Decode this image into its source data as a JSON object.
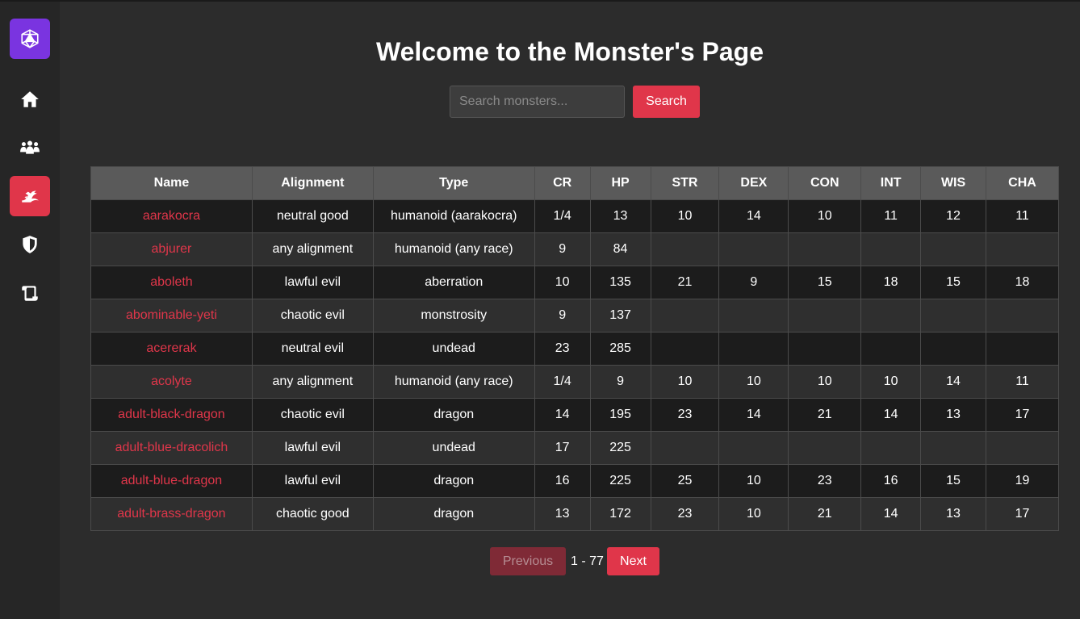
{
  "sidebar": {
    "items": [
      {
        "icon": "d20-dice-icon"
      },
      {
        "icon": "home-icon"
      },
      {
        "icon": "users-icon"
      },
      {
        "icon": "dragon-icon",
        "active": true
      },
      {
        "icon": "shield-icon"
      },
      {
        "icon": "scroll-icon"
      }
    ]
  },
  "page": {
    "title": "Welcome to the Monster's Page"
  },
  "search": {
    "placeholder": "Search monsters...",
    "value": "",
    "button_label": "Search"
  },
  "table": {
    "columns": [
      "Name",
      "Alignment",
      "Type",
      "CR",
      "HP",
      "STR",
      "DEX",
      "CON",
      "INT",
      "WIS",
      "CHA"
    ],
    "rows": [
      [
        "aarakocra",
        "neutral good",
        "humanoid (aarakocra)",
        "1/4",
        "13",
        "10",
        "14",
        "10",
        "11",
        "12",
        "11"
      ],
      [
        "abjurer",
        "any alignment",
        "humanoid (any race)",
        "9",
        "84",
        "",
        "",
        "",
        "",
        "",
        ""
      ],
      [
        "aboleth",
        "lawful evil",
        "aberration",
        "10",
        "135",
        "21",
        "9",
        "15",
        "18",
        "15",
        "18"
      ],
      [
        "abominable-yeti",
        "chaotic evil",
        "monstrosity",
        "9",
        "137",
        "",
        "",
        "",
        "",
        "",
        ""
      ],
      [
        "acererak",
        "neutral evil",
        "undead",
        "23",
        "285",
        "",
        "",
        "",
        "",
        "",
        ""
      ],
      [
        "acolyte",
        "any alignment",
        "humanoid (any race)",
        "1/4",
        "9",
        "10",
        "10",
        "10",
        "10",
        "14",
        "11"
      ],
      [
        "adult-black-dragon",
        "chaotic evil",
        "dragon",
        "14",
        "195",
        "23",
        "14",
        "21",
        "14",
        "13",
        "17"
      ],
      [
        "adult-blue-dracolich",
        "lawful evil",
        "undead",
        "17",
        "225",
        "",
        "",
        "",
        "",
        "",
        ""
      ],
      [
        "adult-blue-dragon",
        "lawful evil",
        "dragon",
        "16",
        "225",
        "25",
        "10",
        "23",
        "16",
        "15",
        "19"
      ],
      [
        "adult-brass-dragon",
        "chaotic good",
        "dragon",
        "13",
        "172",
        "23",
        "10",
        "21",
        "14",
        "13",
        "17"
      ]
    ]
  },
  "pagination": {
    "previous_label": "Previous",
    "range": "1 - 77",
    "next_label": "Next"
  },
  "colors": {
    "accent": "#e0364a",
    "logo": "#7a34e0",
    "background": "#2c2c2c",
    "sidebar": "#262626"
  }
}
